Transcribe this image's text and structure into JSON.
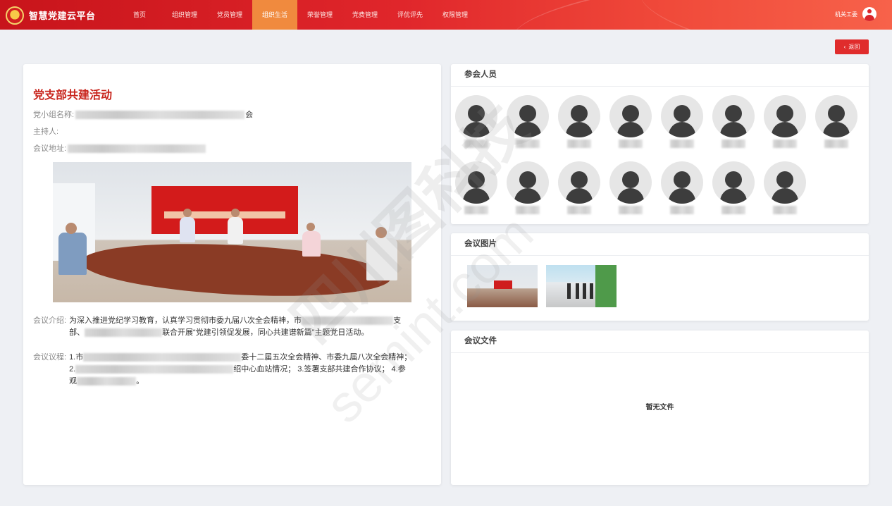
{
  "app": {
    "brand": "智慧党建云平台",
    "user_name": "机关工委"
  },
  "nav": [
    {
      "label": "首页",
      "active": false
    },
    {
      "label": "组织管理",
      "active": false
    },
    {
      "label": "党员管理",
      "active": false
    },
    {
      "label": "组织生活",
      "active": true
    },
    {
      "label": "荣誉管理",
      "active": false
    },
    {
      "label": "党费管理",
      "active": false
    },
    {
      "label": "评优评先",
      "active": false
    },
    {
      "label": "权限管理",
      "active": false
    }
  ],
  "back_label": "返回",
  "meeting": {
    "title": "党支部共建活动",
    "group_label": "党小组名称:",
    "group_value_end": "会",
    "host_label": "主持人:",
    "address_label": "会议地址:",
    "intro_label": "会议介绍:",
    "intro_text_1": "为深入推进党纪学习教育，认真学习贯彻市委九届八次全会精神，市",
    "intro_text_2": "支",
    "intro_text_3": "部、",
    "intro_text_4": "联合开展“党建引领促发展，同心共建谱新篇”主题党日活动。",
    "agenda_label": "会议议程:",
    "agenda_1a": "1.市",
    "agenda_1b": "委十二届五次全会精神、市委九届八次全会精神；",
    "agenda_2a": "2.",
    "agenda_2b": "绍中心血站情况；  3.签署支部共建合作协议；  4.参",
    "agenda_3a": "观",
    "agenda_3b": "。"
  },
  "attendees": {
    "heading": "参会人员",
    "count": 15
  },
  "pictures": {
    "heading": "会议图片"
  },
  "files": {
    "heading": "会议文件",
    "empty_text": "暂无文件"
  },
  "watermark": {
    "line1": "四川图科技",
    "line2": "semint.com"
  },
  "colors": {
    "primary": "#d9262b",
    "accent": "#f08a3e",
    "title": "#c8241c"
  }
}
